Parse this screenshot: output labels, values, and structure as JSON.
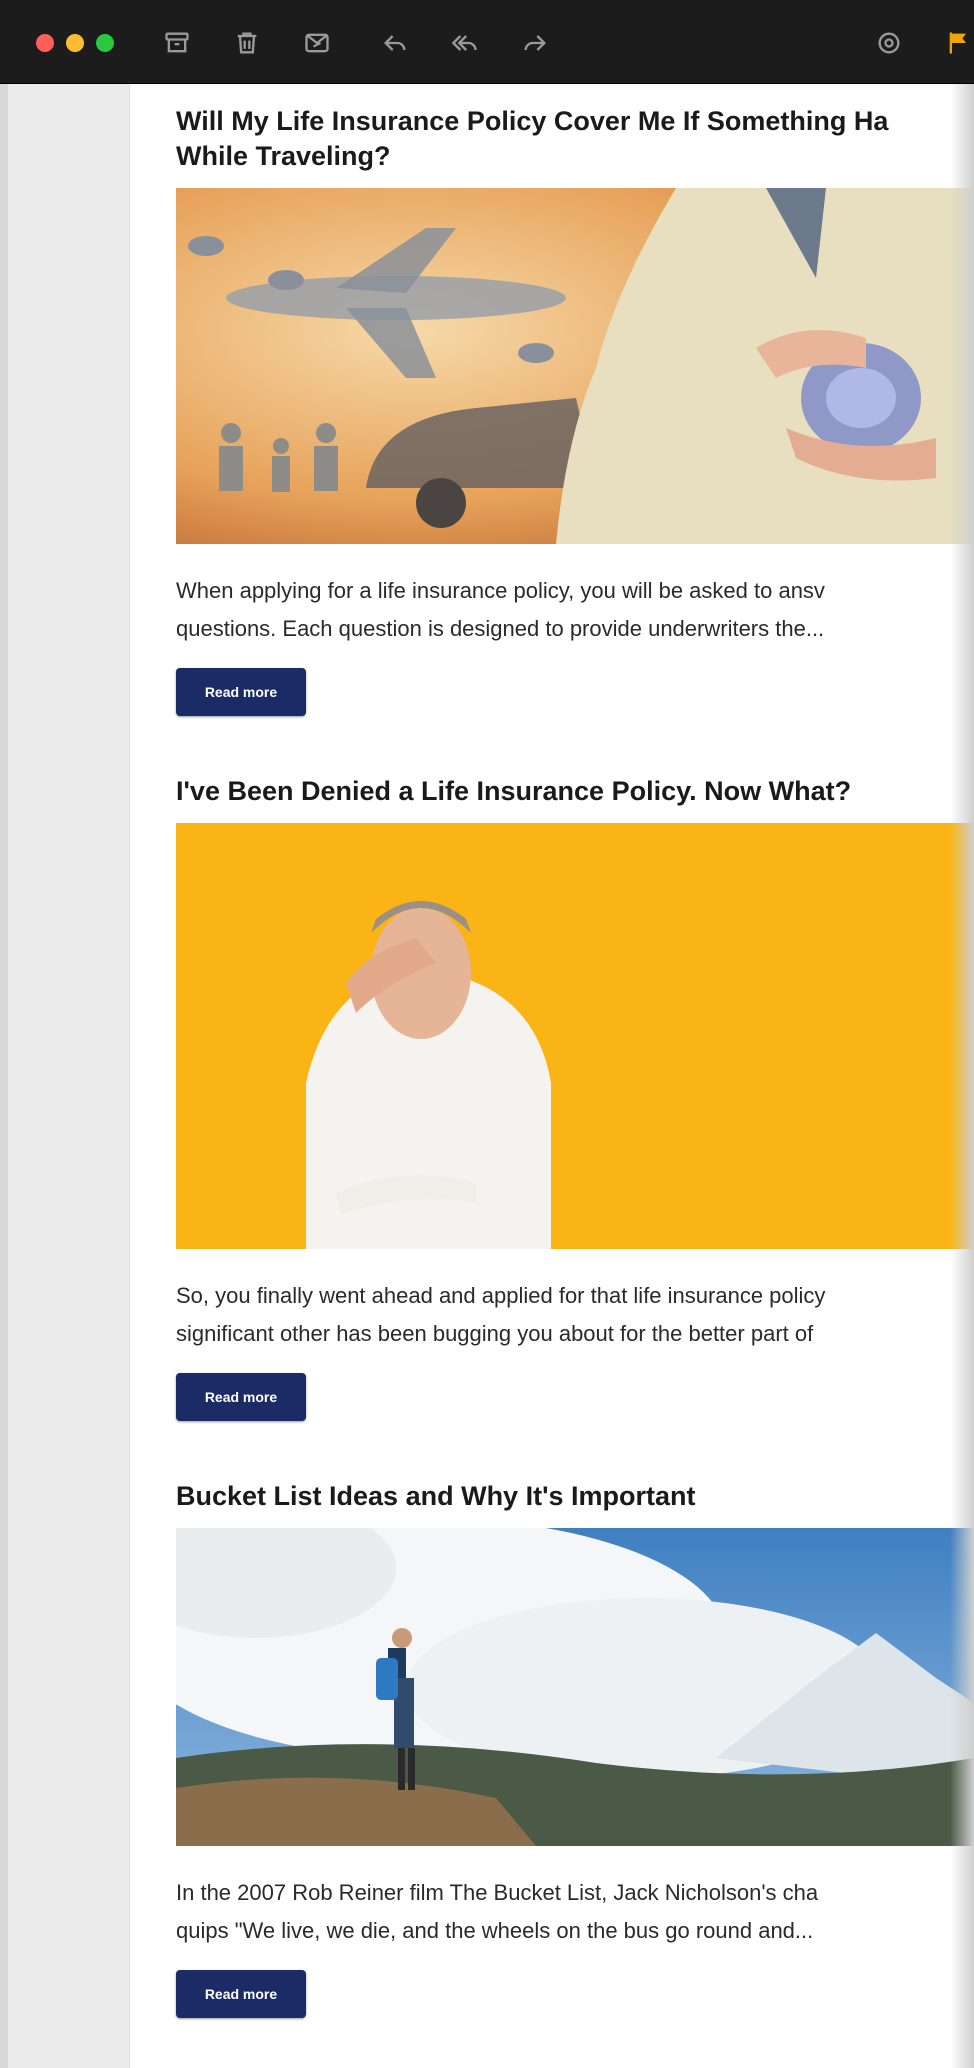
{
  "toolbar": {
    "icons": [
      "archive-icon",
      "trash-icon",
      "junk-icon",
      "reply-icon",
      "reply-all-icon",
      "forward-icon",
      "settings-icon",
      "flag-icon"
    ]
  },
  "articles": [
    {
      "title_line1": "Will My Life Insurance Policy Cover Me If Something Ha",
      "title_line2": "While Traveling?",
      "text_line1": "When applying for a life insurance policy, you will be asked to ansv",
      "text_line2": "questions. Each question is designed to provide underwriters the...",
      "button": "Read more"
    },
    {
      "title_line1": "I've Been Denied a Life Insurance Policy. Now What?",
      "text_line1": "So, you finally went ahead and applied for that life insurance policy",
      "text_line2": "significant other has been bugging you about for the better part of",
      "button": "Read more"
    },
    {
      "title_line1": "Bucket List Ideas and Why It's Important",
      "text_line1": "In the 2007 Rob Reiner film The Bucket List, Jack Nicholson's cha",
      "text_line2": "quips \"We live, we die, and the wheels on the bus go round and...",
      "button": "Read more"
    }
  ],
  "colors": {
    "toolbar_bg": "#1c1c1c",
    "button_bg": "#1b2b66",
    "sidebar_bg": "#ececec",
    "flag": "#f0a500"
  }
}
